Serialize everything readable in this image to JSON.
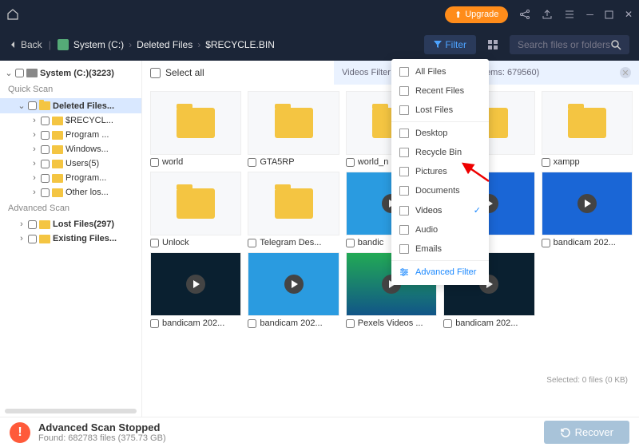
{
  "titlebar": {
    "upgrade": "Upgrade"
  },
  "toolbar": {
    "back": "Back",
    "filter": "Filter",
    "search_ph": "Search files or folders"
  },
  "crumbs": [
    "System (C:)",
    "Deleted Files",
    "$RECYCLE.BIN"
  ],
  "tree": {
    "root": "System (C:)(3223)",
    "quick": "Quick Scan",
    "deleted": "Deleted Files...",
    "children": [
      "$RECYCL...",
      "Program ...",
      "Windows...",
      "Users(5)",
      "Program...",
      "Other los..."
    ],
    "advanced": "Advanced Scan",
    "lost": "Lost Files(297)",
    "existing": "Existing Files..."
  },
  "selectall": "Select all",
  "banner": {
    "pre": "Videos Filter foun",
    "post": "ems: 679560)"
  },
  "items": [
    {
      "n": "world",
      "t": "f"
    },
    {
      "n": "GTA5RP",
      "t": "f"
    },
    {
      "n": "world_n",
      "t": "f"
    },
    {
      "n": "e_end",
      "t": "f"
    },
    {
      "n": "xampp",
      "t": "f"
    },
    {
      "n": "Unlock",
      "t": "f"
    },
    {
      "n": "Telegram Des...",
      "t": "f"
    },
    {
      "n": "bandic",
      "t": "v",
      "c": "win"
    },
    {
      "n": "n 202...",
      "t": "v",
      "c": "blue"
    },
    {
      "n": "bandicam 202...",
      "t": "v",
      "c": "blue"
    },
    {
      "n": "bandicam 202...",
      "t": "v",
      "c": "dark"
    },
    {
      "n": "bandicam 202...",
      "t": "v",
      "c": "win"
    },
    {
      "n": "Pexels Videos ...",
      "t": "v",
      "c": ""
    },
    {
      "n": "bandicam 202...",
      "t": "v",
      "c": "dark"
    }
  ],
  "dd": [
    "All Files",
    "Recent Files",
    "Lost Files",
    "Desktop",
    "Recycle Bin",
    "Pictures",
    "Documents",
    "Videos",
    "Audio",
    "Emails"
  ],
  "dd_adv": "Advanced Filter",
  "footer": {
    "title": "Advanced Scan Stopped",
    "sub": "Found: 682783 files (375.73 GB)",
    "recover": "Recover"
  },
  "selected": "Selected: 0 files (0 KB)"
}
